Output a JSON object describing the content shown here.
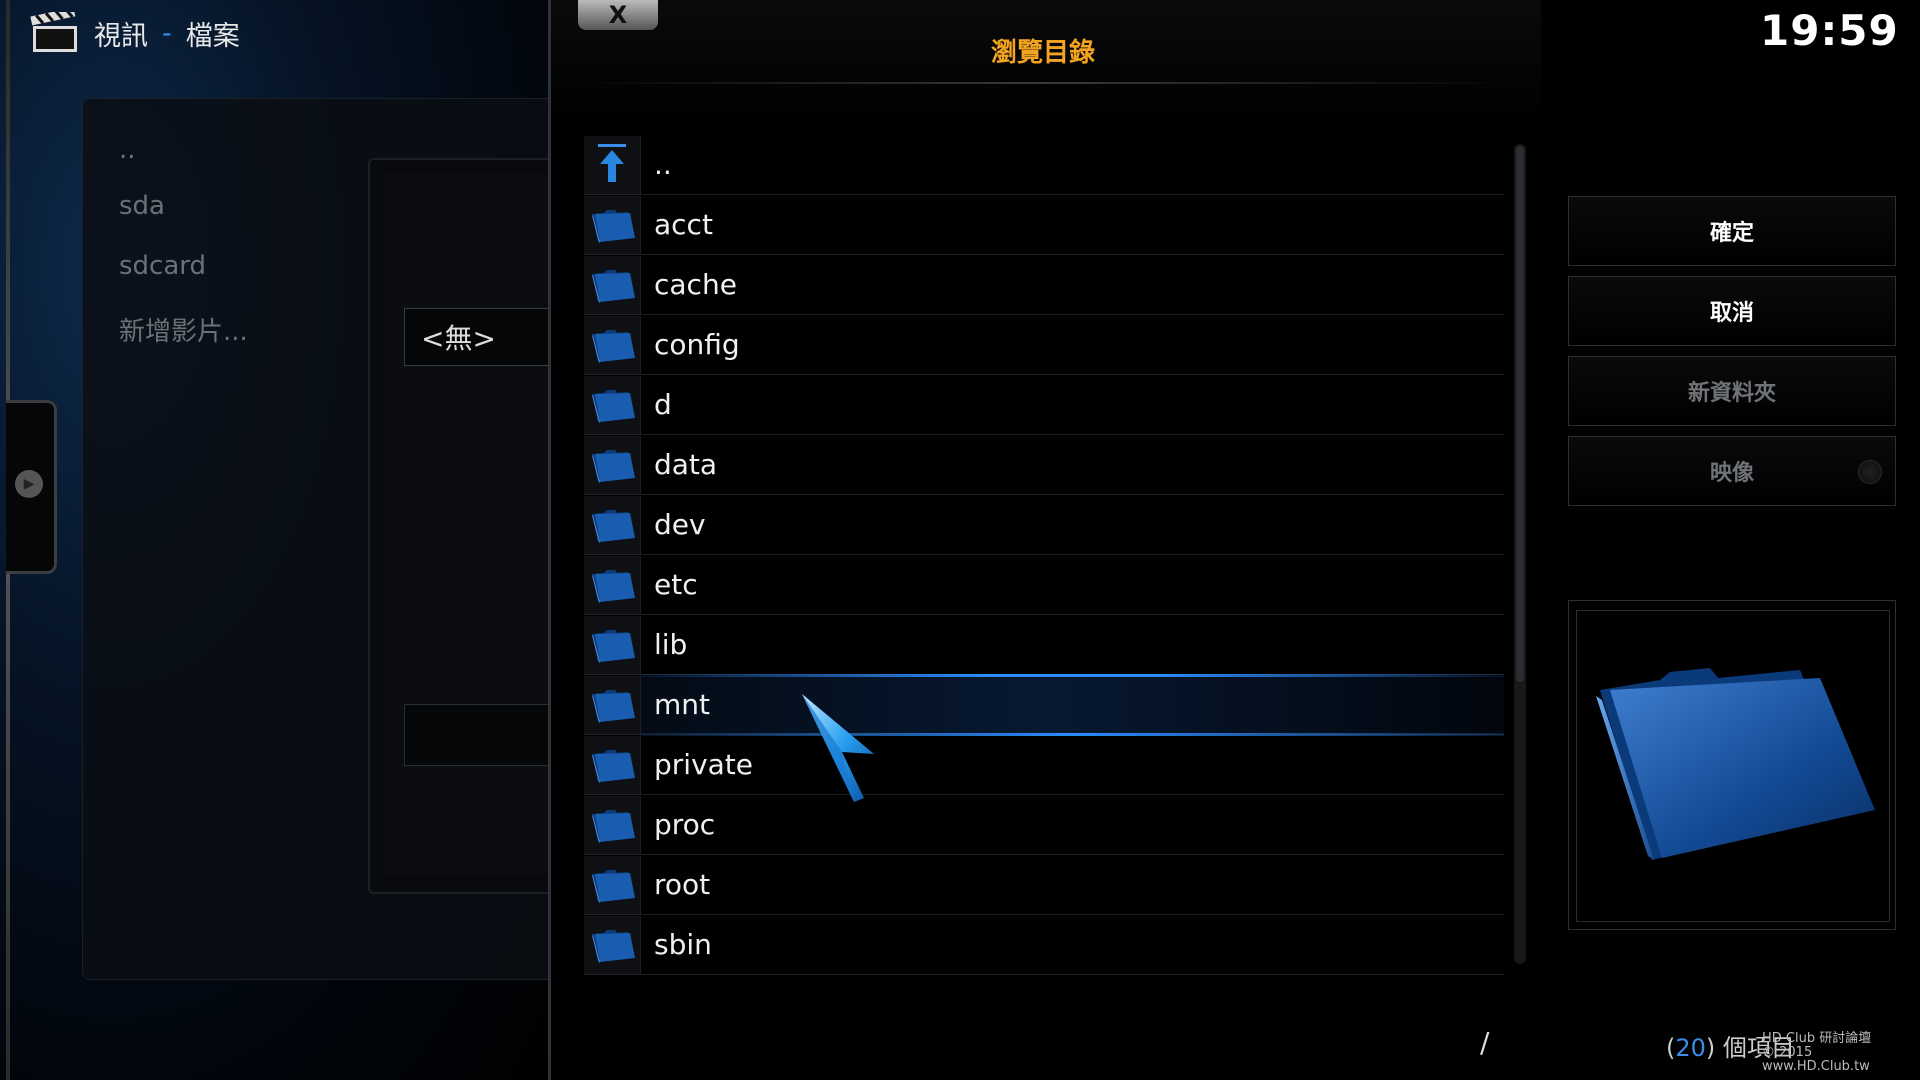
{
  "header": {
    "section": "視訊",
    "separator": "-",
    "page": "檔案",
    "icon": "clapperboard-icon"
  },
  "clock": "19:59",
  "left_panel": {
    "items": [
      "..",
      "sda",
      "sdcard",
      "新增影片..."
    ],
    "none_value": "<無>"
  },
  "dialog": {
    "title": "瀏覽目錄",
    "close_label": "X",
    "entries": [
      {
        "label": "..",
        "icon": "parent-folder-up-icon"
      },
      {
        "label": "acct",
        "icon": "folder-icon"
      },
      {
        "label": "cache",
        "icon": "folder-icon"
      },
      {
        "label": "config",
        "icon": "folder-icon"
      },
      {
        "label": "d",
        "icon": "folder-icon"
      },
      {
        "label": "data",
        "icon": "folder-icon"
      },
      {
        "label": "dev",
        "icon": "folder-icon"
      },
      {
        "label": "etc",
        "icon": "folder-icon"
      },
      {
        "label": "lib",
        "icon": "folder-icon"
      },
      {
        "label": "mnt",
        "icon": "folder-icon",
        "focused": true
      },
      {
        "label": "private",
        "icon": "folder-icon"
      },
      {
        "label": "proc",
        "icon": "folder-icon"
      },
      {
        "label": "root",
        "icon": "folder-icon"
      },
      {
        "label": "sbin",
        "icon": "folder-icon"
      }
    ],
    "current_path": "/"
  },
  "buttons": {
    "ok": "確定",
    "cancel": "取消",
    "new_folder": "新資料夾",
    "mirror": "映像"
  },
  "footer": {
    "count_open": "(",
    "count": "20",
    "count_close": ") 個項目",
    "watermark_line1": "HD Club 研討論壇",
    "watermark_line2": "© 2015  www.HD.Club.tw"
  },
  "colors": {
    "accent": "#3b8ee8",
    "title": "#f2a320",
    "focus": "#2a8cff"
  }
}
